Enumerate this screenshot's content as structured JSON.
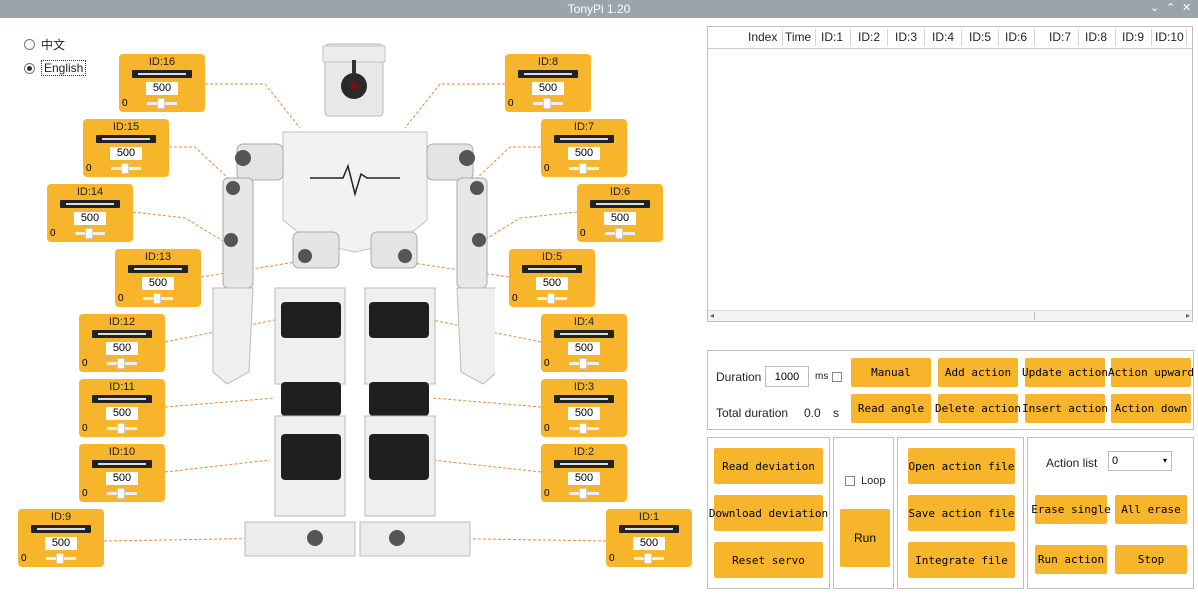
{
  "window": {
    "title": "TonyPi 1.20",
    "controls": [
      "⌄",
      "⌃",
      "✕"
    ]
  },
  "language": {
    "options": [
      {
        "label": "中文",
        "selected": false
      },
      {
        "label": "English",
        "selected": true
      }
    ]
  },
  "servos": [
    {
      "id": "ID:16",
      "value": "500",
      "deviation": "0"
    },
    {
      "id": "ID:15",
      "value": "500",
      "deviation": "0"
    },
    {
      "id": "ID:14",
      "value": "500",
      "deviation": "0"
    },
    {
      "id": "ID:13",
      "value": "500",
      "deviation": "0"
    },
    {
      "id": "ID:12",
      "value": "500",
      "deviation": "0"
    },
    {
      "id": "ID:11",
      "value": "500",
      "deviation": "0"
    },
    {
      "id": "ID:10",
      "value": "500",
      "deviation": "0"
    },
    {
      "id": "ID:9",
      "value": "500",
      "deviation": "0"
    },
    {
      "id": "ID:8",
      "value": "500",
      "deviation": "0"
    },
    {
      "id": "ID:7",
      "value": "500",
      "deviation": "0"
    },
    {
      "id": "ID:6",
      "value": "500",
      "deviation": "0"
    },
    {
      "id": "ID:5",
      "value": "500",
      "deviation": "0"
    },
    {
      "id": "ID:4",
      "value": "500",
      "deviation": "0"
    },
    {
      "id": "ID:3",
      "value": "500",
      "deviation": "0"
    },
    {
      "id": "ID:2",
      "value": "500",
      "deviation": "0"
    },
    {
      "id": "ID:1",
      "value": "500",
      "deviation": "0"
    }
  ],
  "table": {
    "columns": [
      "Index",
      "Time",
      "ID:1",
      "ID:2",
      "ID:3",
      "ID:4",
      "ID:5",
      "ID:6",
      "ID:7",
      "ID:8",
      "ID:9",
      "ID:10"
    ],
    "rows": []
  },
  "edit": {
    "duration_label": "Duration",
    "duration_value": "1000",
    "duration_unit": "ms",
    "total_label": "Total duration",
    "total_value": "0.0",
    "total_unit": "s",
    "manual": "Manual",
    "add_action": "Add action",
    "update_action": "Update action",
    "action_upward": "Action upward",
    "read_angle": "Read angle",
    "delete_action": "Delete action",
    "insert_action": "Insert action",
    "action_down": "Action down"
  },
  "deviation": {
    "read": "Read deviation",
    "download": "Download deviation",
    "reset": "Reset servo"
  },
  "run": {
    "loop": "Loop",
    "run": "Run"
  },
  "files": {
    "open": "Open action file",
    "save": "Save action file",
    "integrate": "Integrate file"
  },
  "actions": {
    "list_label": "Action list",
    "list_value": "0",
    "erase_single": "Erase single",
    "all_erase": "All erase",
    "run_action": "Run action",
    "stop": "Stop"
  },
  "colors": {
    "accent": "#f7b52b",
    "titlebar": "#9aa4ac",
    "servo_black": "#1f1f1f"
  }
}
